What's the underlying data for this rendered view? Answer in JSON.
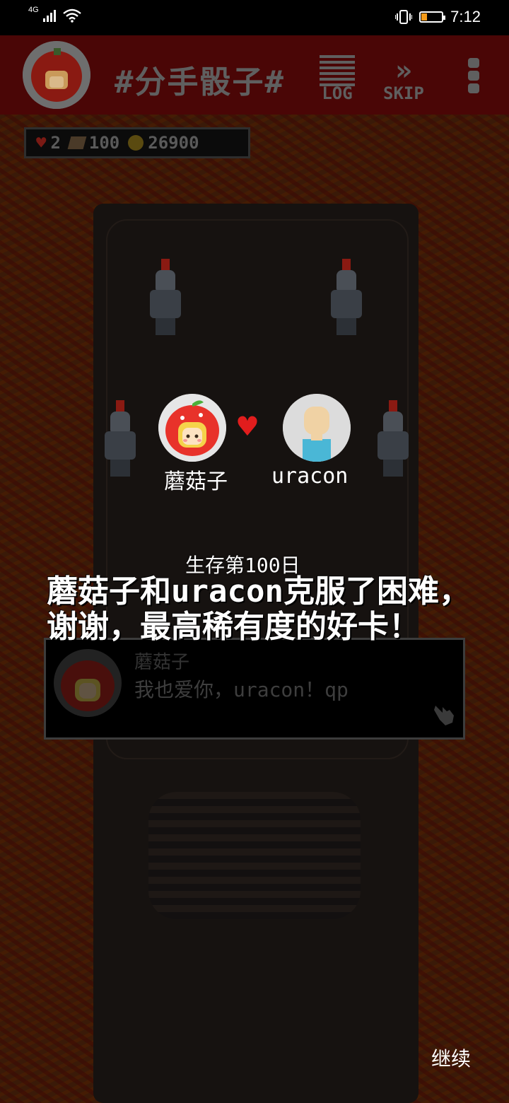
{
  "status_bar": {
    "network": "4G",
    "time": "7:12",
    "battery_level": 0.3
  },
  "header": {
    "title": "#分手骰子#",
    "log_label": "LOG",
    "skip_label": "SKIP",
    "bg_color": "#4a0606"
  },
  "stats": {
    "hearts": "2",
    "books": "100",
    "coins": "26900"
  },
  "pair": {
    "left_name": "蘑菇子",
    "right_name": "uracon",
    "heart_color": "#e11d1d"
  },
  "event": {
    "day_label": "生存第100日",
    "headline": "蘑菇子和uracon克服了困难，谢谢，最高稀有度的好卡！"
  },
  "dialog": {
    "speaker": "蘑菇子",
    "text": "我也爱你，uracon！qp"
  },
  "continue_label": "继续"
}
